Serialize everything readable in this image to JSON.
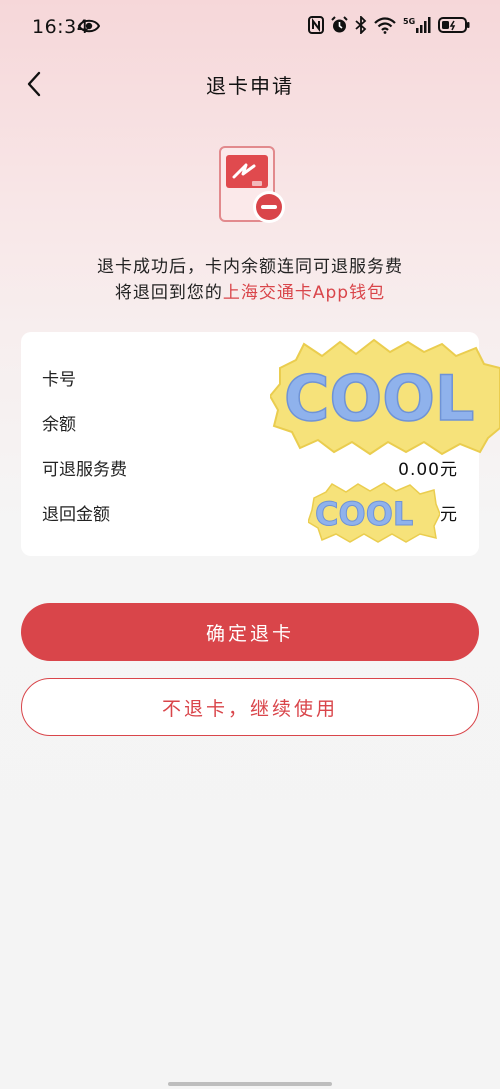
{
  "status_bar": {
    "time": "16:34",
    "network": "5G",
    "icons": [
      "eye-icon",
      "nfc-icon",
      "alarm-icon",
      "bluetooth-icon",
      "wifi-icon",
      "signal-icon",
      "battery-icon"
    ]
  },
  "header": {
    "title": "退卡申请",
    "back_icon": "chevron-left-icon"
  },
  "illustration": {
    "icon": "card-remove-icon"
  },
  "info": {
    "line1": "退卡成功后，卡内余额连同可退服务费",
    "line2_prefix": "将退回到您的",
    "line2_accent": "上海交通卡App钱包"
  },
  "details": {
    "rows": [
      {
        "label": "卡号",
        "value": ""
      },
      {
        "label": "余额",
        "value": ""
      },
      {
        "label": "可退服务费",
        "value": "0.00元"
      },
      {
        "label": "退回金额",
        "value": "元"
      }
    ],
    "sticker_text": "COOL"
  },
  "actions": {
    "confirm_label": "确定退卡",
    "cancel_label": "不退卡，继续使用"
  },
  "colors": {
    "accent": "#d9454a",
    "card_bg": "#ffffff"
  }
}
